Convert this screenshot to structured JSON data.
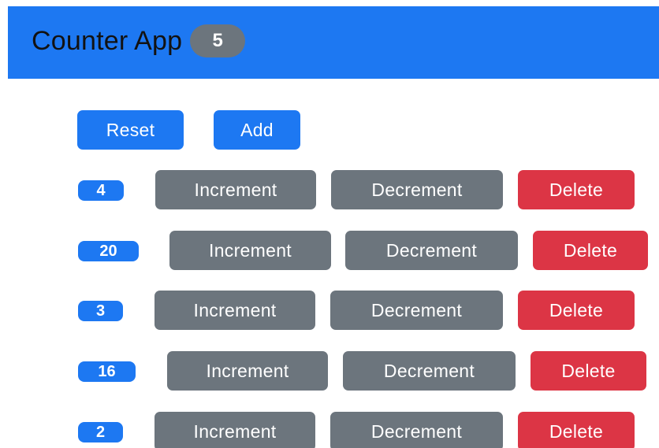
{
  "navbar": {
    "title": "Counter App",
    "total_badge": "5"
  },
  "toolbar": {
    "reset_label": "Reset",
    "add_label": "Add"
  },
  "counters": [
    {
      "value": "4",
      "increment_label": "Increment",
      "decrement_label": "Decrement",
      "delete_label": "Delete"
    },
    {
      "value": "20",
      "increment_label": "Increment",
      "decrement_label": "Decrement",
      "delete_label": "Delete"
    },
    {
      "value": "3",
      "increment_label": "Increment",
      "decrement_label": "Decrement",
      "delete_label": "Delete"
    },
    {
      "value": "16",
      "increment_label": "Increment",
      "decrement_label": "Decrement",
      "delete_label": "Delete"
    },
    {
      "value": "2",
      "increment_label": "Increment",
      "decrement_label": "Decrement",
      "delete_label": "Delete"
    }
  ],
  "colors": {
    "primary": "#1d78f2",
    "secondary": "#6c757d",
    "danger": "#dc3545"
  }
}
